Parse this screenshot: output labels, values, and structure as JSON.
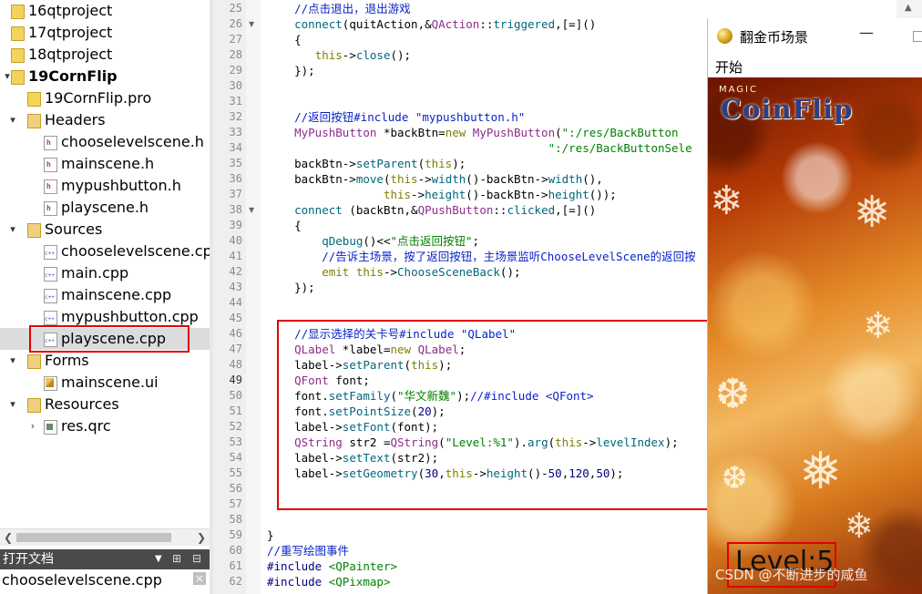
{
  "tree": {
    "items": [
      {
        "label": "16qtproject",
        "kind": "project",
        "bold": false
      },
      {
        "label": "17qtproject",
        "kind": "project",
        "bold": false
      },
      {
        "label": "18qtproject",
        "kind": "project",
        "bold": false
      },
      {
        "label": "19CornFlip",
        "kind": "project",
        "bold": true
      },
      {
        "label": "19CornFlip.pro",
        "kind": "pro"
      },
      {
        "label": "Headers",
        "kind": "folder"
      },
      {
        "label": "chooselevelscene.h",
        "kind": "h"
      },
      {
        "label": "mainscene.h",
        "kind": "h"
      },
      {
        "label": "mypushbutton.h",
        "kind": "h"
      },
      {
        "label": "playscene.h",
        "kind": "h"
      },
      {
        "label": "Sources",
        "kind": "folder"
      },
      {
        "label": "chooselevelscene.cpp",
        "kind": "cpp"
      },
      {
        "label": "main.cpp",
        "kind": "cpp"
      },
      {
        "label": "mainscene.cpp",
        "kind": "cpp"
      },
      {
        "label": "mypushbutton.cpp",
        "kind": "cpp"
      },
      {
        "label": "playscene.cpp",
        "kind": "cpp"
      },
      {
        "label": "Forms",
        "kind": "folder"
      },
      {
        "label": "mainscene.ui",
        "kind": "ui"
      },
      {
        "label": "Resources",
        "kind": "folder"
      },
      {
        "label": "res.qrc",
        "kind": "qrc"
      }
    ]
  },
  "open_documents": {
    "title": "打开文档",
    "current": "chooselevelscene.cpp"
  },
  "editor": {
    "line_numbers": [
      "25",
      "26",
      "27",
      "28",
      "29",
      "30",
      "31",
      "32",
      "33",
      "34",
      "35",
      "36",
      "37",
      "38",
      "39",
      "40",
      "41",
      "42",
      "43",
      "44",
      "45",
      "46",
      "47",
      "48",
      "49",
      "50",
      "51",
      "52",
      "53",
      "54",
      "55",
      "56",
      "57",
      "58",
      "59",
      "60",
      "61",
      "62"
    ],
    "current_line": "49",
    "lines": [
      [
        [
          "    //点击退出，退出游戏",
          "c-cm"
        ]
      ],
      [
        [
          "    ",
          "c-df"
        ],
        [
          "connect",
          "c-fn"
        ],
        [
          "(quitAction,&",
          "c-df"
        ],
        [
          "QAction",
          "c-ty"
        ],
        [
          "::",
          "c-df"
        ],
        [
          "triggered",
          "c-fn"
        ],
        [
          ",[=]()",
          "c-df"
        ]
      ],
      [
        [
          "    {",
          "c-df"
        ]
      ],
      [
        [
          "       ",
          "c-df"
        ],
        [
          "this",
          "c-kw"
        ],
        [
          "->",
          "c-df"
        ],
        [
          "close",
          "c-fn"
        ],
        [
          "();",
          "c-df"
        ]
      ],
      [
        [
          "    });",
          "c-df"
        ]
      ],
      [
        [
          "",
          "c-df"
        ]
      ],
      [
        [
          "",
          "c-df"
        ]
      ],
      [
        [
          "    //返回按钮#include \"mypushbutton.h\"",
          "c-cm"
        ]
      ],
      [
        [
          "    ",
          "c-df"
        ],
        [
          "MyPushButton",
          "c-ty"
        ],
        [
          " *backBtn=",
          "c-df"
        ],
        [
          "new",
          "c-kw"
        ],
        [
          " ",
          "c-df"
        ],
        [
          "MyPushButton",
          "c-ty"
        ],
        [
          "(",
          "c-df"
        ],
        [
          "\":/res/BackButton",
          "c-st"
        ]
      ],
      [
        [
          "                                         ",
          "c-df"
        ],
        [
          "\":/res/BackButtonSele",
          "c-st"
        ]
      ],
      [
        [
          "    backBtn->",
          "c-df"
        ],
        [
          "setParent",
          "c-fn"
        ],
        [
          "(",
          "c-df"
        ],
        [
          "this",
          "c-kw"
        ],
        [
          ");",
          "c-df"
        ]
      ],
      [
        [
          "    backBtn->",
          "c-df"
        ],
        [
          "move",
          "c-fn"
        ],
        [
          "(",
          "c-df"
        ],
        [
          "this",
          "c-kw"
        ],
        [
          "->",
          "c-df"
        ],
        [
          "width",
          "c-fn"
        ],
        [
          "()-backBtn->",
          "c-df"
        ],
        [
          "width",
          "c-fn"
        ],
        [
          "(),",
          "c-df"
        ]
      ],
      [
        [
          "                 ",
          "c-df"
        ],
        [
          "this",
          "c-kw"
        ],
        [
          "->",
          "c-df"
        ],
        [
          "height",
          "c-fn"
        ],
        [
          "()-backBtn->",
          "c-df"
        ],
        [
          "height",
          "c-fn"
        ],
        [
          "());",
          "c-df"
        ]
      ],
      [
        [
          "    ",
          "c-df"
        ],
        [
          "connect",
          "c-fn"
        ],
        [
          " (backBtn,&",
          "c-df"
        ],
        [
          "QPushButton",
          "c-ty"
        ],
        [
          "::",
          "c-df"
        ],
        [
          "clicked",
          "c-fn"
        ],
        [
          ",[=]()",
          "c-df"
        ]
      ],
      [
        [
          "    {",
          "c-df"
        ]
      ],
      [
        [
          "        ",
          "c-df"
        ],
        [
          "qDebug",
          "c-fn"
        ],
        [
          "()<<",
          "c-df"
        ],
        [
          "\"点击返回按钮\"",
          "c-st"
        ],
        [
          ";",
          "c-df"
        ]
      ],
      [
        [
          "        //告诉主场景，按了返回按钮，主场景监听ChooseLevelScene的返回按",
          "c-cm"
        ]
      ],
      [
        [
          "        ",
          "c-df"
        ],
        [
          "emit",
          "c-kw"
        ],
        [
          " ",
          "c-df"
        ],
        [
          "this",
          "c-kw"
        ],
        [
          "->",
          "c-df"
        ],
        [
          "ChooseSceneBack",
          "c-fn"
        ],
        [
          "();",
          "c-df"
        ]
      ],
      [
        [
          "    });",
          "c-df"
        ]
      ],
      [
        [
          "",
          "c-df"
        ]
      ],
      [
        [
          "",
          "c-df"
        ]
      ],
      [
        [
          "    //显示选择的关卡号#include \"QLabel\"",
          "c-cm"
        ]
      ],
      [
        [
          "    ",
          "c-df"
        ],
        [
          "QLabel",
          "c-ty"
        ],
        [
          " *label=",
          "c-df"
        ],
        [
          "new",
          "c-kw"
        ],
        [
          " ",
          "c-df"
        ],
        [
          "QLabel",
          "c-ty"
        ],
        [
          ";",
          "c-df"
        ]
      ],
      [
        [
          "    label->",
          "c-df"
        ],
        [
          "setParent",
          "c-fn"
        ],
        [
          "(",
          "c-df"
        ],
        [
          "this",
          "c-kw"
        ],
        [
          ");",
          "c-df"
        ]
      ],
      [
        [
          "    ",
          "c-df"
        ],
        [
          "QFont",
          "c-ty"
        ],
        [
          " font;",
          "c-df"
        ]
      ],
      [
        [
          "    font.",
          "c-df"
        ],
        [
          "setFamily",
          "c-fn"
        ],
        [
          "(",
          "c-df"
        ],
        [
          "\"华文新魏\"",
          "c-st"
        ],
        [
          ");",
          "c-df"
        ],
        [
          "//#include <QFont>",
          "c-cm"
        ]
      ],
      [
        [
          "    font.",
          "c-df"
        ],
        [
          "setPointSize",
          "c-fn"
        ],
        [
          "(",
          "c-df"
        ],
        [
          "20",
          "c-pl"
        ],
        [
          ");",
          "c-df"
        ]
      ],
      [
        [
          "    label->",
          "c-df"
        ],
        [
          "setFont",
          "c-fn"
        ],
        [
          "(font);",
          "c-df"
        ]
      ],
      [
        [
          "    ",
          "c-df"
        ],
        [
          "QString",
          "c-ty"
        ],
        [
          " str2 =",
          "c-df"
        ],
        [
          "QString",
          "c-ty"
        ],
        [
          "(",
          "c-df"
        ],
        [
          "\"Level:%1\"",
          "c-st"
        ],
        [
          ").",
          "c-df"
        ],
        [
          "arg",
          "c-fn"
        ],
        [
          "(",
          "c-df"
        ],
        [
          "this",
          "c-kw"
        ],
        [
          "->",
          "c-df"
        ],
        [
          "levelIndex",
          "c-fn"
        ],
        [
          ");",
          "c-df"
        ]
      ],
      [
        [
          "    label->",
          "c-df"
        ],
        [
          "setText",
          "c-fn"
        ],
        [
          "(str2);",
          "c-df"
        ]
      ],
      [
        [
          "    label->",
          "c-df"
        ],
        [
          "setGeometry",
          "c-fn"
        ],
        [
          "(",
          "c-df"
        ],
        [
          "30",
          "c-pl"
        ],
        [
          ",",
          "c-df"
        ],
        [
          "this",
          "c-kw"
        ],
        [
          "->",
          "c-df"
        ],
        [
          "height",
          "c-fn"
        ],
        [
          "()-",
          "c-df"
        ],
        [
          "50",
          "c-pl"
        ],
        [
          ",",
          "c-df"
        ],
        [
          "120",
          "c-pl"
        ],
        [
          ",",
          "c-df"
        ],
        [
          "50",
          "c-pl"
        ],
        [
          ");",
          "c-df"
        ]
      ],
      [
        [
          "",
          "c-df"
        ]
      ],
      [
        [
          "",
          "c-df"
        ]
      ],
      [
        [
          "",
          "c-df"
        ]
      ],
      [
        [
          "}",
          "c-df"
        ]
      ],
      [
        [
          "//重写绘图事件",
          "c-cm"
        ]
      ],
      [
        [
          "#include ",
          "c-pl"
        ],
        [
          "<QPainter>",
          "c-st"
        ]
      ],
      [
        [
          "#include ",
          "c-pl"
        ],
        [
          "<QPixmap>",
          "c-st"
        ]
      ]
    ]
  },
  "game_window": {
    "title": "翻金币场景",
    "min": "—",
    "menu": "开始",
    "logo_top": "MAGIC",
    "logo": "CoinFlip",
    "level_text": "Level:5"
  },
  "watermark": "CSDN @不断进步的咸鱼"
}
